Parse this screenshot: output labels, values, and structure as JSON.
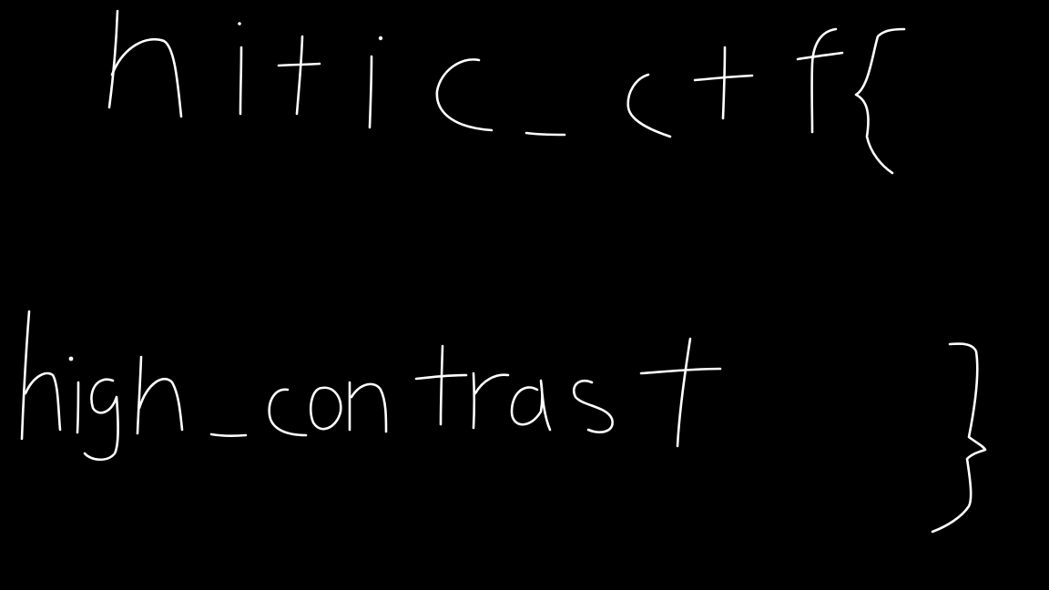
{
  "background_color": "#000000",
  "ink_color": "#ffffff",
  "handwriting": {
    "line1": "hitic_ctf{",
    "line2": "high_contrast",
    "closing": "}"
  }
}
